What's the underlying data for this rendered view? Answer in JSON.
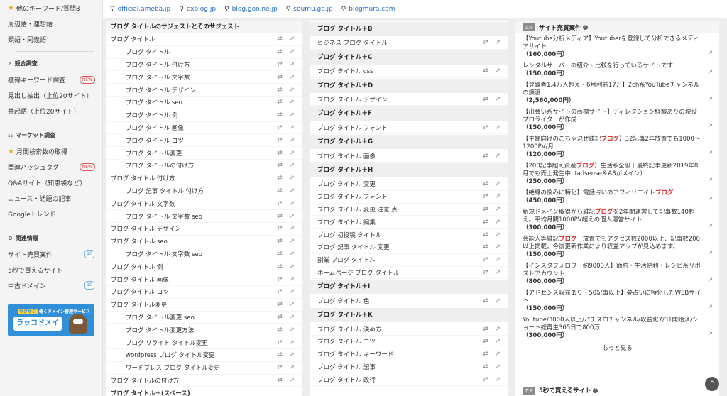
{
  "sidebar": {
    "top_item": "他のキーワード/質問β",
    "items_a": [
      "周辺語・連想語",
      "類語・同義語"
    ],
    "section_kyogo": "競合調査",
    "items_b": [
      "獲得キーワード調査",
      "見出し抽出（上位20サイト）",
      "共起語（上位20サイト）"
    ],
    "new_badge": "NEW",
    "section_market": "マーケット調査",
    "items_c": [
      "月間検索数の取得",
      "関連ハッシュタグ",
      "Q&Aサイト（知恵袋など）",
      "ニュース・話題の記事",
      "Googleトレンド"
    ],
    "section_related": "関連情報",
    "items_d": [
      "サイト売買案件",
      "5秒で買えるサイト",
      "中古ドメイン"
    ],
    "count_badge": "10",
    "banner_sub_saku": "サクサク",
    "banner_sub": "俺くドメイン管理サービス",
    "banner_main": "ラッコドメイン"
  },
  "topbar": {
    "links": [
      "official.ameba.jp",
      "exblog.jp",
      "blog.goo.ne.jp",
      "soumu.go.jp",
      "blogmura.com"
    ]
  },
  "col1": {
    "title": "ブログ タイトルのサジェストとそのサジェスト",
    "rows": [
      "ブログ タイトル",
      "ブログ タイトル",
      "ブログ タイトル 付け方",
      "ブログ タイトル 文字数",
      "ブログ タイトル デザイン",
      "ブログ タイトル seo",
      "ブログ タイトル 例",
      "ブログ タイトル 画像",
      "ブログ タイトル コツ",
      "ブログ タイトル変更",
      "ブログ タイトルの付け方",
      "ブログ タイトル 付け方",
      "ブログ 記事 タイトル 付け方",
      "ブログ タイトル 文字数",
      "ブログ タイトル 文字数 seo",
      "ブログ タイトル デザイン",
      "ブログ タイトル seo",
      "ブログ タイトル 文字数 seo",
      "ブログ タイトル 例",
      "ブログ タイトル 画像",
      "ブログ タイトル コツ",
      "ブログ タイトル変更",
      "ブログ タイトル変更 seo",
      "ブログ タイトル変更方法",
      "ブログ リライト タイトル変更",
      "wordpress ブログ タイトル変更",
      "ワードプレス ブログ タイトル変更",
      "ブログ タイトルの付け方"
    ],
    "bottom_head": "ブログ タイトル＋(スペース)"
  },
  "col2": {
    "groups": [
      {
        "head": "ブログ タイトル＋B",
        "rows": [
          "ビジネス ブログ タイトル"
        ]
      },
      {
        "head": "ブログ タイトル＋C",
        "rows": [
          "ブログ タイトル css"
        ]
      },
      {
        "head": "ブログ タイトル＋D",
        "rows": [
          "ブログ タイトル デザイン"
        ]
      },
      {
        "head": "ブログ タイトル＋F",
        "rows": [
          "ブログ タイトル フォント"
        ]
      },
      {
        "head": "ブログ タイトル＋G",
        "rows": [
          "ブログ タイトル 画像"
        ]
      },
      {
        "head": "ブログ タイトル＋H",
        "rows": [
          "ブログ タイトル 変更",
          "ブログ タイトル フォント",
          "ブログ タイトル 変更 注意 点",
          "ブログ タイトル 編集",
          "ブログ 初投稿 タイトル",
          "ブログ 記事 タイトル 変更",
          "副業 ブログ タイトル",
          "ホームページ ブログ タイトル"
        ]
      },
      {
        "head": "ブログ タイトル＋I",
        "rows": [
          "ブログ タイトル 色"
        ]
      },
      {
        "head": "ブログ タイトル＋K",
        "rows": [
          "ブログ タイトル 決め方",
          "ブログ タイトル コツ",
          "ブログ タイトル キーワード",
          "ブログ タイトル 記事",
          "ブログ タイトル 改行"
        ]
      }
    ]
  },
  "col3": {
    "ad_tag": "広告",
    "title": "サイト売買案件",
    "ads": [
      {
        "pre": "【Youtube分析メディア】Youtuberを登録して分析できるメディアサイト",
        "hl": "",
        "post": "",
        "price": "（160,000円）"
      },
      {
        "pre": "レンタルサーバーの紹介・比較を行っているサイトです",
        "hl": "",
        "post": "",
        "price": "（150,000円）"
      },
      {
        "pre": "【登録者1.4万人超え・6月利益17万】2ch系YouTubeチャンネルの譲渡",
        "hl": "",
        "post": "",
        "price": "（2,560,000円）"
      },
      {
        "pre": "【出会い系サイトの商標サイト】ディレクション経験ありの現役プロライターが作成",
        "hl": "",
        "post": "",
        "price": "（150,000円）"
      },
      {
        "pre": "【主婦向けのごちゃ混ぜ雑記",
        "hl": "ブログ",
        "post": "】32記事2年放置でも1000〜1200PV/月",
        "price": "（120,000円）"
      },
      {
        "pre": "【200記事超え資産",
        "hl": "ブログ",
        "post": "】生活系全般｜最終記事更新2019年8月でも売上発生中（adsense＆A8がメイン）",
        "price": "（250,000円）"
      },
      {
        "pre": "【絶縁の悩みに特化】電話占いのアフィリエイト",
        "hl": "ブログ",
        "post": "",
        "price": "（450,000円）"
      },
      {
        "pre": "新規ドメイン取得から雑記",
        "hl": "ブログ",
        "post": "を2年間運営して記事数140超え。平均月間1000PV超えの個人運営サイト",
        "price": "（300,000円）"
      },
      {
        "pre": "芸能人等雑記",
        "hl": "ブログ",
        "post": "　放置でもアクセス数2000以上、記事数200以上掲載。今後更新作業により収益アップが見込めます。",
        "price": "（150,000円）"
      },
      {
        "pre": "【インスタフォロワー約9000人】節約・生活便利・レシピ系リポストアカウント",
        "hl": "",
        "post": "",
        "price": "（800,000円）"
      },
      {
        "pre": "【アドセンス収益あり・50記事以上】夢占いに特化したWEBサイト",
        "hl": "",
        "post": "",
        "price": "（150,000円）"
      },
      {
        "pre": "Youtube/3000人以上/パチスロチャンネル/収益化7/31開始済/ショート総再生365日で800万",
        "hl": "",
        "post": "",
        "price": "（300,000円）"
      }
    ],
    "more": "もっと見る",
    "bottom_title": "5秒で買えるサイト"
  }
}
